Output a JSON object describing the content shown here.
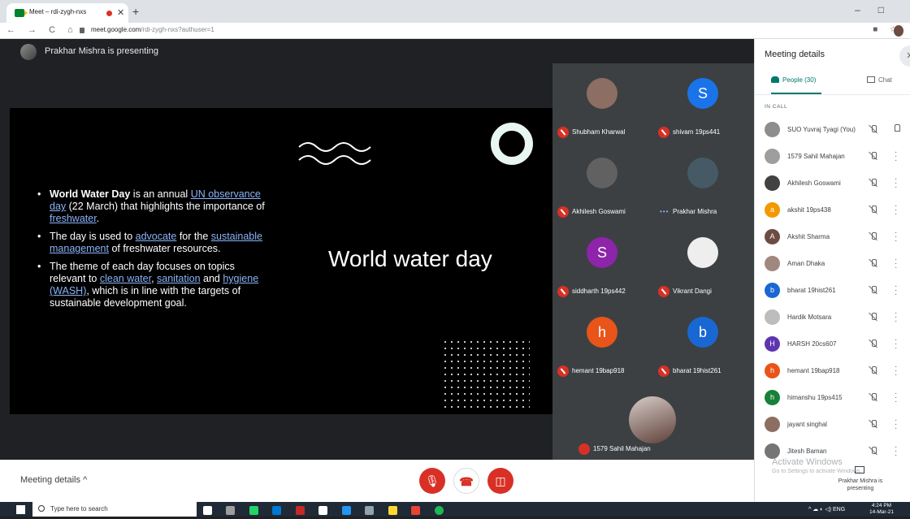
{
  "browser": {
    "tab_title": "Meet – rdi-zygh-nxs",
    "tab_close": "✕",
    "new_tab": "+",
    "url_host": "meet.google.com",
    "url_path": "/rdi-zygh-nxs?authuser=1",
    "nav_icons": "← → C ⌂",
    "window_controls": "–□"
  },
  "meet": {
    "presenting_text": "Prakhar Mishra is presenting"
  },
  "slide": {
    "title": "World water day",
    "bullet1_bold": "World Water Day",
    "bullet1_a": " is an annual ",
    "bullet1_link1": "UN observance day",
    "bullet1_b": " (22 March) that highlights the importance of ",
    "bullet1_link2": "freshwater",
    "bullet1_c": ".",
    "bullet2_a": "The day is used to ",
    "bullet2_link1": "advocate",
    "bullet2_b": " for the ",
    "bullet2_link2": "sustainable management",
    "bullet2_c": " of freshwater resources.",
    "bullet3_a": "The theme of each day focuses on topics relevant to ",
    "bullet3_link1": "clean water",
    "bullet3_b": ", ",
    "bullet3_link2": "sanitation",
    "bullet3_c": " and ",
    "bullet3_link3": "hygiene (WASH)",
    "bullet3_d": ", which is in line with the targets of sustainable development goal."
  },
  "tiles": [
    {
      "name": "Shubham Kharwal",
      "initial": "",
      "color": "#8d6e63"
    },
    {
      "name": "shivam 19ps441",
      "initial": "S",
      "color": "#1a73e8"
    },
    {
      "name": "Akhilesh Goswami",
      "initial": "",
      "color": "#616161"
    },
    {
      "name": "Prakhar Mishra",
      "initial": "",
      "color": "#455a64"
    },
    {
      "name": "siddharth 19ps442",
      "initial": "S",
      "color": "#8e24aa"
    },
    {
      "name": "Vikrant Dangi",
      "initial": "",
      "color": "#eeeeee"
    },
    {
      "name": "hemant 19bap918",
      "initial": "h",
      "color": "#e8541a"
    },
    {
      "name": "bharat 19hist261",
      "initial": "b",
      "color": "#1967d2"
    }
  ],
  "tile_last": {
    "name": "1579 Sahil Mahajan"
  },
  "speaking_indicator": "•••",
  "bottom": {
    "meeting_details": "Meeting details",
    "chevron": "^",
    "mic_icon": "🎙",
    "end_icon": "☎",
    "cam_icon": "◫"
  },
  "panel": {
    "title": "Meeting details",
    "close": "✕",
    "people_tab": "People (30)",
    "chat_tab": "Chat",
    "in_call": "IN CALL",
    "people": [
      {
        "name": "SUO Yuvraj Tyagi (You)",
        "initial": "",
        "color": "#8d8d8d"
      },
      {
        "name": "1579 Sahil Mahajan",
        "initial": "",
        "color": "#9e9e9e"
      },
      {
        "name": "Akhilesh Goswami",
        "initial": "",
        "color": "#424242"
      },
      {
        "name": "akshit 19ps438",
        "initial": "a",
        "color": "#f29900"
      },
      {
        "name": "Akshit Sharma",
        "initial": "A",
        "color": "#6d4c41"
      },
      {
        "name": "Aman Dhaka",
        "initial": "",
        "color": "#a1887f"
      },
      {
        "name": "bharat 19hist261",
        "initial": "b",
        "color": "#1967d2"
      },
      {
        "name": "Hardik Motsara",
        "initial": "",
        "color": "#bdbdbd"
      },
      {
        "name": "HARSH 20cs607",
        "initial": "H",
        "color": "#5e35b1"
      },
      {
        "name": "hemant 19bap918",
        "initial": "h",
        "color": "#e8541a"
      },
      {
        "name": "himanshu 19ps415",
        "initial": "h",
        "color": "#188038"
      },
      {
        "name": "jayant singhal",
        "initial": "",
        "color": "#8d6e63"
      },
      {
        "name": "Jitesh Baman",
        "initial": "",
        "color": "#757575"
      }
    ]
  },
  "watermark": {
    "line1": "Activate Windows",
    "line2": "Go to Settings to activate Windows."
  },
  "present_note": "Prakhar Mishra is presenting",
  "taskbar": {
    "search_placeholder": "Type here to search",
    "tray": "^ ☁ ◐ ◁) ENG",
    "time": "4:24 PM",
    "date": "14-Mar-21"
  }
}
